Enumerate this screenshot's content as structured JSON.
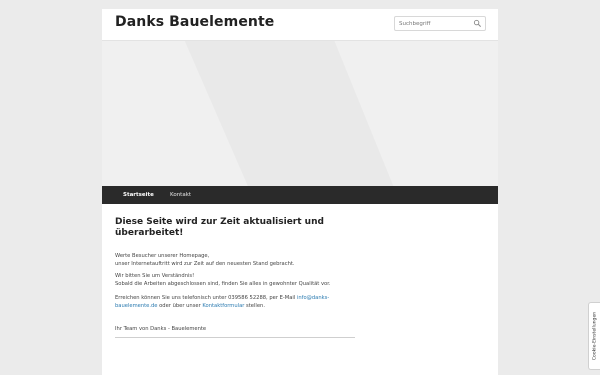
{
  "header": {
    "site_title": "Danks Bauelemente",
    "search_placeholder": "Suchbegriff",
    "search_icon": "search-icon"
  },
  "nav": {
    "items": [
      {
        "label": "Startseite",
        "active": true
      },
      {
        "label": "Kontakt",
        "active": false
      }
    ]
  },
  "main": {
    "heading": "Diese Seite wird zur Zeit aktualisiert und überarbeitet!",
    "para1_line1": "Werte Besucher unserer Homepage,",
    "para1_line2": "unser Internetauftritt wird zur Zeit auf den neuesten Stand gebracht.",
    "para2_line1": "Wir bitten Sie um Verständnis!",
    "para2_line2": "Sobald die Arbeiten abgeschlossen sind, finden Sie alles in gewohnter Qualität vor.",
    "contact_prefix": "Erreichen können Sie uns telefonisch unter 039586 52288, per E-Mail ",
    "email_link": "info@danks-bauelemente.de",
    "contact_middle": " oder über unser ",
    "form_link": "Kontaktformular",
    "contact_suffix": " stellen.",
    "signature": "Ihr Team von Danks - Bauelemente"
  },
  "cookie_tab": {
    "label": "Cookie-Einstellungen"
  }
}
